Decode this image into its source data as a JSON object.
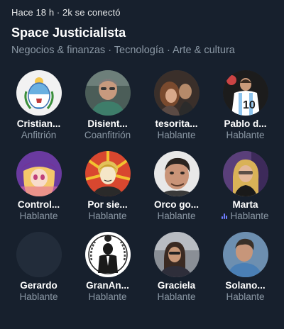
{
  "header": {
    "meta": "Hace 18 h · 2k se conectó",
    "title": "Space Justicialista",
    "topics": "Negocios &  finanzas · Tecnología · Arte & cultura"
  },
  "participants": [
    {
      "name": "Cristian...",
      "role": "Anfitrión",
      "avatar": "argentina-shield-avatar"
    },
    {
      "name": "Disient...",
      "role": "Coanfitrión",
      "avatar": "man-photo-avatar"
    },
    {
      "name": "tesorita...",
      "role": "Hablante",
      "avatar": "couple-photo-avatar"
    },
    {
      "name": "Pablo d...",
      "role": "Hablante",
      "avatar": "footballer-photo-avatar"
    },
    {
      "name": "Control...",
      "role": "Hablante",
      "avatar": "anime-girl-avatar"
    },
    {
      "name": "Por sie...",
      "role": "Hablante",
      "avatar": "evita-portrait-avatar"
    },
    {
      "name": "Orco go...",
      "role": "Hablante",
      "avatar": "man-closeup-avatar"
    },
    {
      "name": "Marta",
      "role": "Hablante",
      "avatar": "woman-photo-avatar",
      "speaking": true
    },
    {
      "name": "Gerardo",
      "role": "Hablante",
      "avatar": "empty-avatar"
    },
    {
      "name": "GranAn...",
      "role": "Hablante",
      "avatar": "anonymous-logo-avatar"
    },
    {
      "name": "Graciela",
      "role": "Hablante",
      "avatar": "woman-selfie-avatar"
    },
    {
      "name": "Solano...",
      "role": "Hablante",
      "avatar": "man-portrait-avatar"
    }
  ],
  "colors": {
    "background": "#17202d",
    "muted_text": "#8b98a5",
    "speaking_accent": "#6f7dff"
  }
}
